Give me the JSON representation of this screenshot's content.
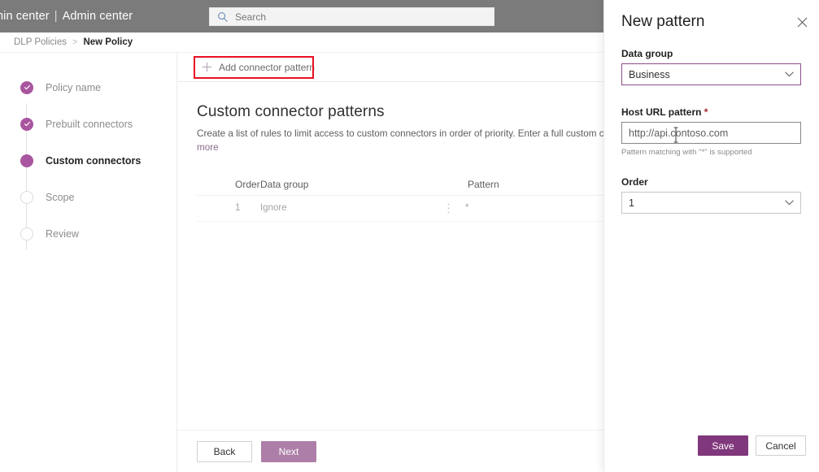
{
  "suitebar": {
    "title_truncated": "min center",
    "separator": "|",
    "title_full": "Admin center",
    "search": {
      "placeholder": "Search",
      "icon": "search-icon"
    }
  },
  "breadcrumb": {
    "parent": "DLP Policies",
    "separator": ">",
    "current": "New Policy"
  },
  "wizard": {
    "steps": [
      {
        "label": "Policy name",
        "state": "done"
      },
      {
        "label": "Prebuilt connectors",
        "state": "done"
      },
      {
        "label": "Custom connectors",
        "state": "current"
      },
      {
        "label": "Scope",
        "state": "todo"
      },
      {
        "label": "Review",
        "state": "todo"
      }
    ]
  },
  "commandbar": {
    "add_pattern_label": "Add connector pattern",
    "add_pattern_icon": "plus-icon",
    "highlight_color": "#e81123"
  },
  "main": {
    "heading": "Custom connector patterns",
    "description": "Create a list of rules to limit access to custom connectors in order of priority. Enter a full custom connector U",
    "description_link": "more",
    "table": {
      "columns": [
        "Order",
        "Data group",
        "Pattern"
      ],
      "rows": [
        {
          "order": "1",
          "data_group": "Ignore",
          "pattern": "*",
          "menu_icon": "kebab-menu-icon"
        }
      ]
    },
    "footer": {
      "back_label": "Back",
      "next_label": "Next"
    }
  },
  "panel": {
    "title": "New pattern",
    "close_icon": "close-icon",
    "data_group": {
      "label": "Data group",
      "value": "Business",
      "icon": "chevron-down-icon"
    },
    "host_url": {
      "label": "Host URL pattern",
      "required_marker": "*",
      "value": "http://api.contoso.com",
      "hint": "Pattern matching with \"*\" is supported"
    },
    "order": {
      "label": "Order",
      "value": "1",
      "icon": "chevron-down-icon"
    },
    "actions": {
      "save_label": "Save",
      "cancel_label": "Cancel"
    }
  },
  "colors": {
    "suitebar_bg": "#7b7b7b",
    "accent_purple": "#80377b",
    "step_purple": "#a9559f",
    "muted_purple": "#ad7fa8",
    "annotation_red": "#e81123"
  }
}
